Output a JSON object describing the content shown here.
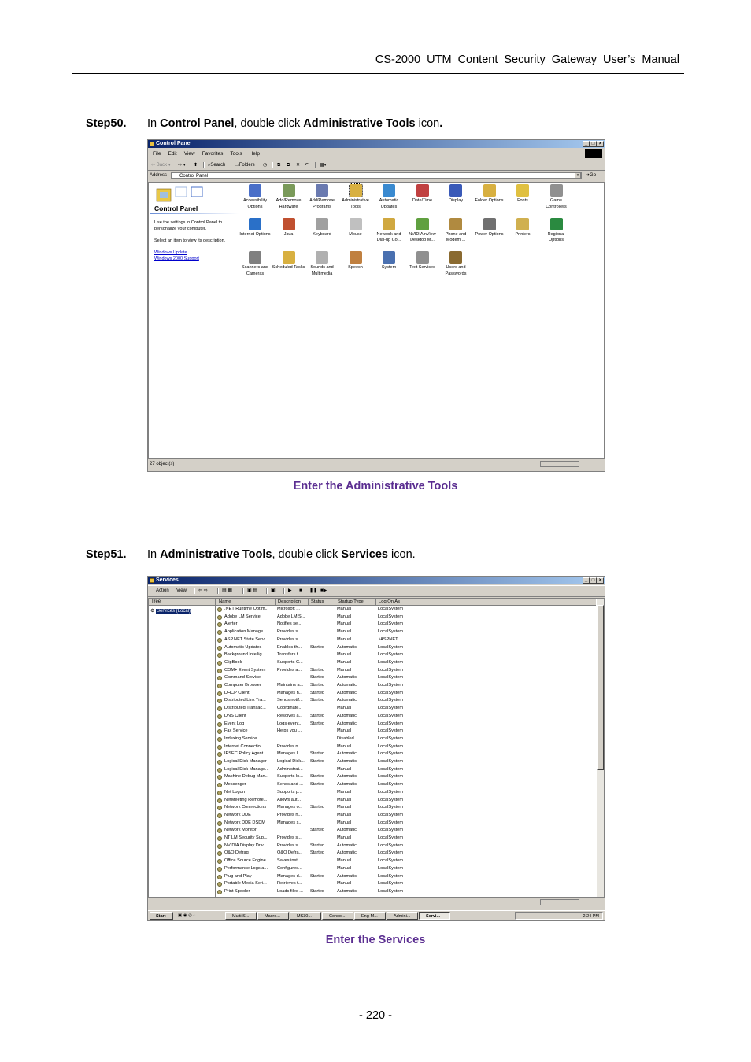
{
  "header": {
    "title": "CS-2000  UTM  Content  Security  Gateway  User’s  Manual"
  },
  "step50": {
    "label": "Step50.",
    "pre": "In ",
    "b1": "Control Panel",
    "mid": ", double click ",
    "b2": "Administrative Tools",
    "post": " icon",
    "end": "."
  },
  "cp": {
    "title": "Control Panel",
    "menu": [
      "File",
      "Edit",
      "View",
      "Favorites",
      "Tools",
      "Help"
    ],
    "toolbar": {
      "back": "Back",
      "search": "Search",
      "folders": "Folders"
    },
    "address_label": "Address",
    "address_value": "Control Panel",
    "go": "Go",
    "panel_title": "Control Panel",
    "desc": "Use the settings in Control Panel to personalize your computer.",
    "hint": "Select an item to view its description.",
    "links": [
      "Windows Update",
      "Windows 2000 Support"
    ],
    "icons": [
      {
        "label": "Accessibility Options",
        "color": "#4a6fc8",
        "icon": "accessibility-icon"
      },
      {
        "label": "Add/Remove Hardware",
        "color": "#7a9a5a",
        "icon": "hardware-icon"
      },
      {
        "label": "Add/Remove Programs",
        "color": "#6a7ab0",
        "icon": "programs-icon"
      },
      {
        "label": "Administrative Tools",
        "color": "#d8b040",
        "icon": "admin-tools-icon"
      },
      {
        "label": "Automatic Updates",
        "color": "#3a8ad0",
        "icon": "updates-icon"
      },
      {
        "label": "Date/Time",
        "color": "#c04040",
        "icon": "calendar-icon"
      },
      {
        "label": "Display",
        "color": "#3a5ab8",
        "icon": "display-icon"
      },
      {
        "label": "Folder Options",
        "color": "#d8b040",
        "icon": "folder-icon"
      },
      {
        "label": "Fonts",
        "color": "#e0c040",
        "icon": "fonts-icon"
      },
      {
        "label": "Game Controllers",
        "color": "#909090",
        "icon": "joystick-icon"
      },
      {
        "label": "Internet Options",
        "color": "#2a70c8",
        "icon": "globe-icon"
      },
      {
        "label": "Java",
        "color": "#c05030",
        "icon": "java-icon"
      },
      {
        "label": "Keyboard",
        "color": "#a0a0a0",
        "icon": "keyboard-icon"
      },
      {
        "label": "Mouse",
        "color": "#c0c0c0",
        "icon": "mouse-icon"
      },
      {
        "label": "Network and Dial-up Co...",
        "color": "#d0a840",
        "icon": "network-icon"
      },
      {
        "label": "NVIDIA nView Desktop M...",
        "color": "#60a040",
        "icon": "nvidia-icon"
      },
      {
        "label": "Phone and Modem ...",
        "color": "#b08a40",
        "icon": "phone-icon"
      },
      {
        "label": "Power Options",
        "color": "#707070",
        "icon": "power-icon"
      },
      {
        "label": "Printers",
        "color": "#d0b050",
        "icon": "printer-icon"
      },
      {
        "label": "Regional Options",
        "color": "#2a8a40",
        "icon": "globe-icon"
      },
      {
        "label": "Scanners and Cameras",
        "color": "#808080",
        "icon": "scanner-icon"
      },
      {
        "label": "Scheduled Tasks",
        "color": "#d8b040",
        "icon": "tasks-icon"
      },
      {
        "label": "Sounds and Multimedia",
        "color": "#b0b0b0",
        "icon": "speaker-icon"
      },
      {
        "label": "Speech",
        "color": "#c08040",
        "icon": "speech-icon"
      },
      {
        "label": "System",
        "color": "#4a70b0",
        "icon": "computer-icon"
      },
      {
        "label": "Text Services",
        "color": "#909090",
        "icon": "text-services-icon"
      },
      {
        "label": "Users and Passwords",
        "color": "#8a6a30",
        "icon": "users-icon"
      }
    ],
    "status": "27 object(s)"
  },
  "caption1": "Enter the Administrative Tools",
  "step51": {
    "label": "Step51.",
    "pre": "In ",
    "b1": "Administrative Tools",
    "mid": ", double click ",
    "b2": "Services",
    "post": " icon."
  },
  "svc": {
    "title": "Services",
    "menu": [
      "Action",
      "View"
    ],
    "tree_tab": "Tree",
    "tree_node": "Services (Local)",
    "columns": [
      "Name",
      "Description",
      "Status",
      "Startup Type",
      "Log On As"
    ],
    "rows": [
      [
        ".NET Runtime Optim...",
        "Microsoft ...",
        "",
        "Manual",
        "LocalSystem"
      ],
      [
        "Adobe LM Service",
        "Adobe LM S...",
        "",
        "Manual",
        "LocalSystem"
      ],
      [
        "Alerter",
        "Notifies sel...",
        "",
        "Manual",
        "LocalSystem"
      ],
      [
        "Application Manage...",
        "Provides s...",
        "",
        "Manual",
        "LocalSystem"
      ],
      [
        "ASP.NET State Serv...",
        "Provides s...",
        "",
        "Manual",
        ".\\ASPNET"
      ],
      [
        "Automatic Updates",
        "Enables th...",
        "Started",
        "Automatic",
        "LocalSystem"
      ],
      [
        "Background Intellig...",
        "Transfers f...",
        "",
        "Manual",
        "LocalSystem"
      ],
      [
        "ClipBook",
        "Supports C...",
        "",
        "Manual",
        "LocalSystem"
      ],
      [
        "COM+ Event System",
        "Provides a...",
        "Started",
        "Manual",
        "LocalSystem"
      ],
      [
        "Command Service",
        "",
        "Started",
        "Automatic",
        "LocalSystem"
      ],
      [
        "Computer Browser",
        "Maintains a...",
        "Started",
        "Automatic",
        "LocalSystem"
      ],
      [
        "DHCP Client",
        "Manages n...",
        "Started",
        "Automatic",
        "LocalSystem"
      ],
      [
        "Distributed Link Tra...",
        "Sends notif...",
        "Started",
        "Automatic",
        "LocalSystem"
      ],
      [
        "Distributed Transac...",
        "Coordinate...",
        "",
        "Manual",
        "LocalSystem"
      ],
      [
        "DNS Client",
        "Resolves a...",
        "Started",
        "Automatic",
        "LocalSystem"
      ],
      [
        "Event Log",
        "Logs event...",
        "Started",
        "Automatic",
        "LocalSystem"
      ],
      [
        "Fax Service",
        "Helps you ...",
        "",
        "Manual",
        "LocalSystem"
      ],
      [
        "Indexing Service",
        "",
        "",
        "Disabled",
        "LocalSystem"
      ],
      [
        "Internet Connectio...",
        "Provides n...",
        "",
        "Manual",
        "LocalSystem"
      ],
      [
        "IPSEC Policy Agent",
        "Manages I...",
        "Started",
        "Automatic",
        "LocalSystem"
      ],
      [
        "Logical Disk Manager",
        "Logical Disk...",
        "Started",
        "Automatic",
        "LocalSystem"
      ],
      [
        "Logical Disk Manage...",
        "Administrat...",
        "",
        "Manual",
        "LocalSystem"
      ],
      [
        "Machine Debug Man...",
        "Supports lo...",
        "Started",
        "Automatic",
        "LocalSystem"
      ],
      [
        "Messenger",
        "Sends and ...",
        "Started",
        "Automatic",
        "LocalSystem"
      ],
      [
        "Net Logon",
        "Supports p...",
        "",
        "Manual",
        "LocalSystem"
      ],
      [
        "NetMeeting Remote...",
        "Allows aut...",
        "",
        "Manual",
        "LocalSystem"
      ],
      [
        "Network Connections",
        "Manages o...",
        "Started",
        "Manual",
        "LocalSystem"
      ],
      [
        "Network DDE",
        "Provides n...",
        "",
        "Manual",
        "LocalSystem"
      ],
      [
        "Network DDE DSDM",
        "Manages s...",
        "",
        "Manual",
        "LocalSystem"
      ],
      [
        "Network Monitor",
        "",
        "Started",
        "Automatic",
        "LocalSystem"
      ],
      [
        "NT LM Security Sup...",
        "Provides s...",
        "",
        "Manual",
        "LocalSystem"
      ],
      [
        "NVIDIA Display Driv...",
        "Provides s...",
        "Started",
        "Automatic",
        "LocalSystem"
      ],
      [
        "O&O Defrag",
        "O&O Defra...",
        "Started",
        "Automatic",
        "LocalSystem"
      ],
      [
        "Office Source Engine",
        "Saves inst...",
        "",
        "Manual",
        "LocalSystem"
      ],
      [
        "Performance Logs a...",
        "Configures...",
        "",
        "Manual",
        "LocalSystem"
      ],
      [
        "Plug and Play",
        "Manages d...",
        "Started",
        "Automatic",
        "LocalSystem"
      ],
      [
        "Portable Media Seri...",
        "Retrieves t...",
        "",
        "Manual",
        "LocalSystem"
      ],
      [
        "Print Spooler",
        "Loads files ...",
        "Started",
        "Automatic",
        "LocalSystem"
      ]
    ],
    "start": "Start",
    "tasks": [
      "Multi S...",
      "Macro...",
      "MS30...",
      "Conso...",
      "Eng-M...",
      "Admini...",
      "Servi..."
    ],
    "clock": "2:24 PM"
  },
  "caption2": "Enter the Services",
  "footer": {
    "page": "- 220 -"
  }
}
